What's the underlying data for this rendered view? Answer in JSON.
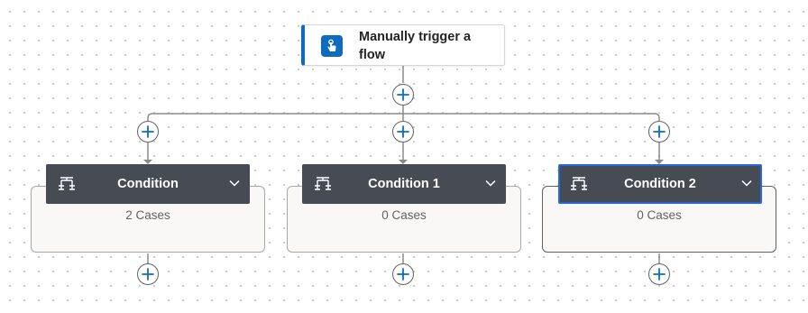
{
  "trigger": {
    "title": "Manually trigger a flow",
    "icon": "touch-hand-icon",
    "accent_color": "#0f6cbd"
  },
  "add_step_icon": "plus-icon",
  "conditions": [
    {
      "title": "Condition",
      "cases": "2 Cases",
      "icon": "condition-icon",
      "selected": false
    },
    {
      "title": "Condition 1",
      "cases": "0 Cases",
      "icon": "condition-icon",
      "selected": false
    },
    {
      "title": "Condition 2",
      "cases": "0 Cases",
      "icon": "condition-icon",
      "selected": true
    }
  ],
  "colors": {
    "header_bg": "#474b53",
    "selected_border": "#2666e0",
    "plus_blue": "#0f6cbd"
  }
}
